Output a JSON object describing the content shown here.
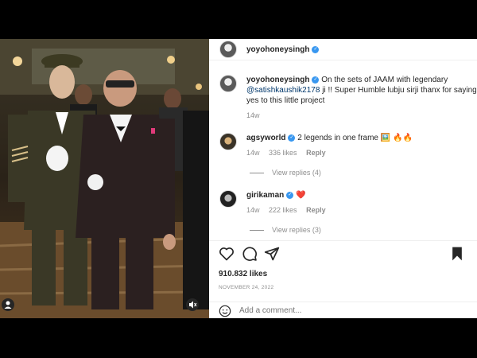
{
  "header": {
    "username": "yoyohoneysingh"
  },
  "comments": [
    {
      "username": "yoyohoneysingh",
      "text_before": " On the sets of JAAM with legendary ",
      "mention": "@satishkaushik2178",
      "text_after": " ji !! Super Humble lubju sirji thanx for saying yes to this little project",
      "time": "14w"
    },
    {
      "username": "agsyworld",
      "text": " 2 legends in one frame 🖼️ 🔥🔥",
      "time": "14w",
      "likes": "336 likes",
      "reply": "Reply",
      "view_replies": "View replies (4)"
    },
    {
      "username": "girikaman",
      "text": " ❤️",
      "time": "14w",
      "likes": "222 likes",
      "reply": "Reply",
      "view_replies": "View replies (3)"
    }
  ],
  "post": {
    "likes": "910.832 likes",
    "date": "NOVEMBER 24, 2022",
    "add_comment_placeholder": "Add a comment..."
  },
  "icons": [
    "heart-icon",
    "comment-icon",
    "share-icon",
    "bookmark-icon",
    "user-tag-icon",
    "mute-icon"
  ]
}
